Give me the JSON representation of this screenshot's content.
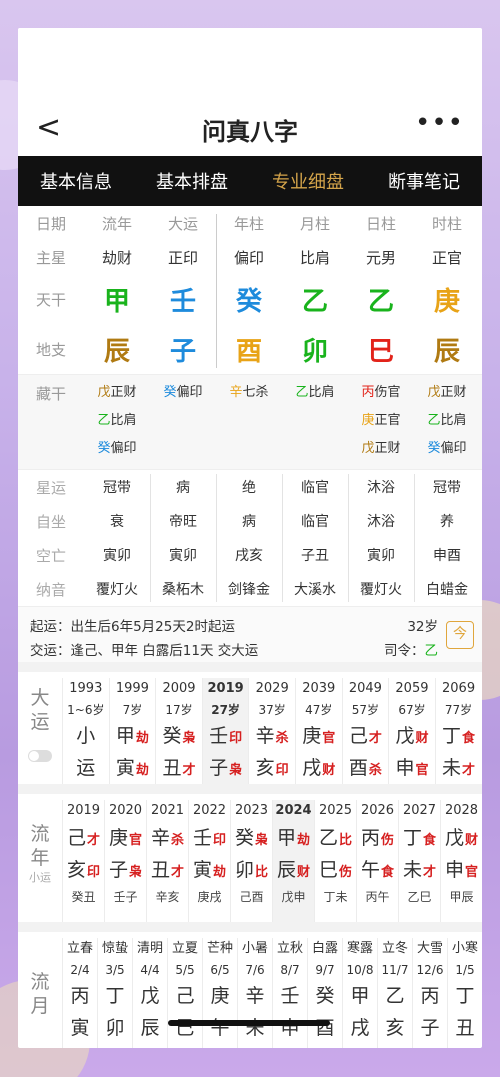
{
  "colors": {
    "wood": "#19b31c",
    "water": "#1e8bdc",
    "fire": "#e2231a",
    "earth": "#b07a12",
    "metal": "#e8a317",
    "accent": "#d4a44a",
    "shensha": "#d62020"
  },
  "nav": {
    "back": "<",
    "title": "问真八字",
    "more": "•••"
  },
  "tabs": [
    {
      "label": "基本信息",
      "active": false
    },
    {
      "label": "基本排盘",
      "active": false
    },
    {
      "label": "专业细盘",
      "active": true
    },
    {
      "label": "断事笔记",
      "active": false
    }
  ],
  "headers": {
    "label": "日期",
    "cols": [
      "流年",
      "大运",
      "年柱",
      "月柱",
      "日柱",
      "时柱"
    ]
  },
  "zhuxing": {
    "label": "主星",
    "cols": [
      "劫财",
      "正印",
      "偏印",
      "比肩",
      "元男",
      "正官"
    ]
  },
  "tiangan": {
    "label": "天干",
    "cols": [
      {
        "t": "甲",
        "c": "wood"
      },
      {
        "t": "壬",
        "c": "water"
      },
      {
        "t": "癸",
        "c": "water"
      },
      {
        "t": "乙",
        "c": "wood"
      },
      {
        "t": "乙",
        "c": "wood"
      },
      {
        "t": "庚",
        "c": "metal"
      }
    ]
  },
  "dizhi": {
    "label": "地支",
    "cols": [
      {
        "t": "辰",
        "c": "earth"
      },
      {
        "t": "子",
        "c": "water"
      },
      {
        "t": "酉",
        "c": "metal"
      },
      {
        "t": "卯",
        "c": "wood"
      },
      {
        "t": "巳",
        "c": "fire"
      },
      {
        "t": "辰",
        "c": "earth"
      }
    ]
  },
  "canggan": {
    "label": "藏干",
    "cols": [
      [
        {
          "g": "戊",
          "c": "earth",
          "s": "正财"
        },
        {
          "g": "乙",
          "c": "wood",
          "s": "比肩"
        },
        {
          "g": "癸",
          "c": "water",
          "s": "偏印"
        }
      ],
      [
        {
          "g": "癸",
          "c": "water",
          "s": "偏印"
        }
      ],
      [
        {
          "g": "辛",
          "c": "metal",
          "s": "七杀"
        }
      ],
      [
        {
          "g": "乙",
          "c": "wood",
          "s": "比肩"
        }
      ],
      [
        {
          "g": "丙",
          "c": "fire",
          "s": "伤官"
        },
        {
          "g": "庚",
          "c": "metal",
          "s": "正官"
        },
        {
          "g": "戊",
          "c": "earth",
          "s": "正财"
        }
      ],
      [
        {
          "g": "戊",
          "c": "earth",
          "s": "正财"
        },
        {
          "g": "乙",
          "c": "wood",
          "s": "比肩"
        },
        {
          "g": "癸",
          "c": "water",
          "s": "偏印"
        }
      ]
    ]
  },
  "xingyun": {
    "label": "星运",
    "cols": [
      "冠带",
      "病",
      "绝",
      "临官",
      "沐浴",
      "冠带"
    ]
  },
  "zizuo": {
    "label": "自坐",
    "cols": [
      "衰",
      "帝旺",
      "病",
      "临官",
      "沐浴",
      "养"
    ]
  },
  "kongwang": {
    "label": "空亡",
    "cols": [
      "寅卯",
      "寅卯",
      "戌亥",
      "子丑",
      "寅卯",
      "申酉"
    ]
  },
  "nayin": {
    "label": "纳音",
    "cols": [
      "覆灯火",
      "桑柘木",
      "剑锋金",
      "大溪水",
      "覆灯火",
      "白蜡金"
    ]
  },
  "info": {
    "qiyun": "起运：出生后6年5月25天2时起运",
    "jiaoyun": "交运：逢己、甲年 白露后11天 交大运",
    "age": "32岁",
    "siling": "司令：",
    "siling_val": "乙",
    "cal_icon": "今"
  },
  "dayun": {
    "label": "大运",
    "cols": [
      {
        "yr": "1993",
        "ag": "1~6岁",
        "g": "小",
        "gs": "",
        "z": "运",
        "zs": ""
      },
      {
        "yr": "1999",
        "ag": "7岁",
        "g": "甲",
        "gs": "劫",
        "z": "寅",
        "zs": "劫"
      },
      {
        "yr": "2009",
        "ag": "17岁",
        "g": "癸",
        "gs": "枭",
        "z": "丑",
        "zs": "才"
      },
      {
        "yr": "2019",
        "ag": "27岁",
        "g": "壬",
        "gs": "印",
        "z": "子",
        "zs": "枭",
        "sel": true
      },
      {
        "yr": "2029",
        "ag": "37岁",
        "g": "辛",
        "gs": "杀",
        "z": "亥",
        "zs": "印"
      },
      {
        "yr": "2039",
        "ag": "47岁",
        "g": "庚",
        "gs": "官",
        "z": "戌",
        "zs": "财"
      },
      {
        "yr": "2049",
        "ag": "57岁",
        "g": "己",
        "gs": "才",
        "z": "酉",
        "zs": "杀"
      },
      {
        "yr": "2059",
        "ag": "67岁",
        "g": "戊",
        "gs": "财",
        "z": "申",
        "zs": "官"
      },
      {
        "yr": "2069",
        "ag": "77岁",
        "g": "丁",
        "gs": "食",
        "z": "未",
        "zs": "才"
      }
    ]
  },
  "liunian": {
    "label": "流年",
    "sub": "小运",
    "cols": [
      {
        "yr": "2019",
        "g": "己",
        "gs": "才",
        "z": "亥",
        "zs": "印",
        "nm": "癸丑"
      },
      {
        "yr": "2020",
        "g": "庚",
        "gs": "官",
        "z": "子",
        "zs": "枭",
        "nm": "壬子"
      },
      {
        "yr": "2021",
        "g": "辛",
        "gs": "杀",
        "z": "丑",
        "zs": "才",
        "nm": "辛亥"
      },
      {
        "yr": "2022",
        "g": "壬",
        "gs": "印",
        "z": "寅",
        "zs": "劫",
        "nm": "庚戌"
      },
      {
        "yr": "2023",
        "g": "癸",
        "gs": "枭",
        "z": "卯",
        "zs": "比",
        "nm": "己酉"
      },
      {
        "yr": "2024",
        "g": "甲",
        "gs": "劫",
        "z": "辰",
        "zs": "财",
        "nm": "戊申",
        "sel": true
      },
      {
        "yr": "2025",
        "g": "乙",
        "gs": "比",
        "z": "巳",
        "zs": "伤",
        "nm": "丁未"
      },
      {
        "yr": "2026",
        "g": "丙",
        "gs": "伤",
        "z": "午",
        "zs": "食",
        "nm": "丙午"
      },
      {
        "yr": "2027",
        "g": "丁",
        "gs": "食",
        "z": "未",
        "zs": "才",
        "nm": "乙巳"
      },
      {
        "yr": "2028",
        "g": "戊",
        "gs": "财",
        "z": "申",
        "zs": "官",
        "nm": "甲辰"
      }
    ]
  },
  "liuyue": {
    "label": "流月",
    "cols": [
      {
        "jq": "立春",
        "d": "2/4",
        "g": "丙",
        "z": "寅"
      },
      {
        "jq": "惊蛰",
        "d": "3/5",
        "g": "丁",
        "z": "卯"
      },
      {
        "jq": "清明",
        "d": "4/4",
        "g": "戊",
        "z": "辰"
      },
      {
        "jq": "立夏",
        "d": "5/5",
        "g": "己",
        "z": "巳"
      },
      {
        "jq": "芒种",
        "d": "6/5",
        "g": "庚",
        "z": "午"
      },
      {
        "jq": "小暑",
        "d": "7/6",
        "g": "辛",
        "z": "未"
      },
      {
        "jq": "立秋",
        "d": "8/7",
        "g": "壬",
        "z": "申"
      },
      {
        "jq": "白露",
        "d": "9/7",
        "g": "癸",
        "z": "酉"
      },
      {
        "jq": "寒露",
        "d": "10/8",
        "g": "甲",
        "z": "戌"
      },
      {
        "jq": "立冬",
        "d": "11/7",
        "g": "乙",
        "z": "亥"
      },
      {
        "jq": "大雪",
        "d": "12/6",
        "g": "丙",
        "z": "子"
      },
      {
        "jq": "小寒",
        "d": "1/5",
        "g": "丁",
        "z": "丑"
      }
    ]
  }
}
